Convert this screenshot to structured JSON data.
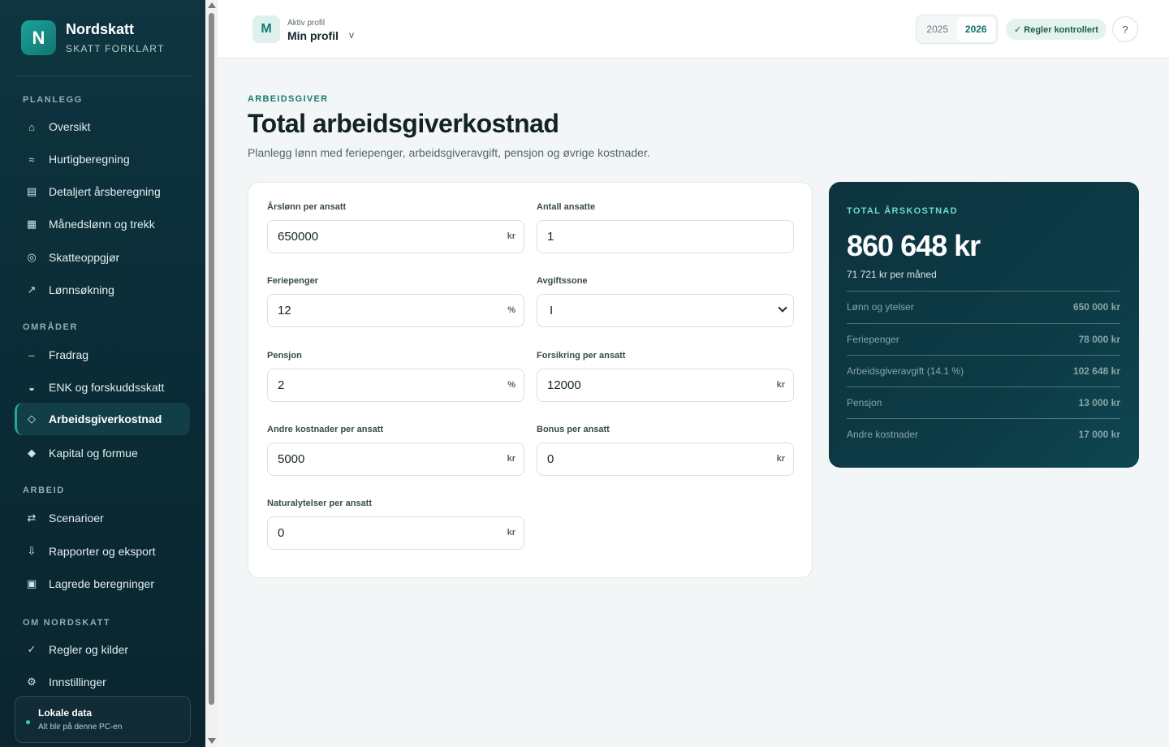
{
  "brand": {
    "logo_letter": "N",
    "name": "Nordskatt",
    "subtitle": "SKATT FORKLART"
  },
  "sidebar": {
    "sections": [
      {
        "label": "PLANLEGG"
      },
      {
        "label": "OMRÅDER"
      },
      {
        "label": "ARBEID"
      },
      {
        "label": "OM NORDSKATT"
      }
    ],
    "items": [
      {
        "label": "Oversikt",
        "icon": "home-icon",
        "glyph": "⌂"
      },
      {
        "label": "Hurtigberegning",
        "icon": "approx-icon",
        "glyph": "≈"
      },
      {
        "label": "Detaljert årsberegning",
        "icon": "document-icon",
        "glyph": "▤"
      },
      {
        "label": "Månedslønn og trekk",
        "icon": "grid-icon",
        "glyph": "▦"
      },
      {
        "label": "Skatteoppgjør",
        "icon": "target-icon",
        "glyph": "◎"
      },
      {
        "label": "Lønnsøkning",
        "icon": "trend-up-icon",
        "glyph": "↗"
      },
      {
        "label": "Fradrag",
        "icon": "minus-icon",
        "glyph": "–"
      },
      {
        "label": "ENK og forskuddsskatt",
        "icon": "half-circle-icon",
        "glyph": "◒"
      },
      {
        "label": "Arbeidsgiverkostnad",
        "icon": "diamond-outline-icon",
        "glyph": "◇",
        "active": true
      },
      {
        "label": "Kapital og formue",
        "icon": "diamond-icon",
        "glyph": "◆"
      },
      {
        "label": "Scenarioer",
        "icon": "swap-icon",
        "glyph": "⇄"
      },
      {
        "label": "Rapporter og eksport",
        "icon": "download-icon",
        "glyph": "⇩"
      },
      {
        "label": "Lagrede beregninger",
        "icon": "save-icon",
        "glyph": "▣"
      },
      {
        "label": "Regler og kilder",
        "icon": "check-icon",
        "glyph": "✓"
      },
      {
        "label": "Innstillinger",
        "icon": "gear-icon",
        "glyph": "⚙"
      }
    ],
    "local_data": {
      "title": "Lokale data",
      "subtitle": "Alt blir på denne PC-en"
    }
  },
  "header": {
    "profile": {
      "avatar_letter": "M",
      "caption": "Aktiv profil",
      "name": "Min profil",
      "chevron": "v"
    },
    "years": [
      "2025",
      "2026"
    ],
    "active_year": "2026",
    "rules_badge": "✓ Regler kontrollert",
    "help": "?"
  },
  "page": {
    "eyebrow": "ARBEIDSGIVER",
    "title": "Total arbeidsgiverkostnad",
    "description": "Planlegg lønn med feriepenger, arbeidsgiveravgift, pensjon og øvrige kostnader."
  },
  "form": {
    "annual_salary": {
      "label": "Årslønn per ansatt",
      "value": "650000",
      "unit": "kr"
    },
    "employees": {
      "label": "Antall ansatte",
      "value": "1"
    },
    "holiday_pay": {
      "label": "Feriepenger",
      "value": "12",
      "unit": "%"
    },
    "tax_zone": {
      "label": "Avgiftssone",
      "value": "I"
    },
    "pension": {
      "label": "Pensjon",
      "value": "2",
      "unit": "%"
    },
    "insurance": {
      "label": "Forsikring per ansatt",
      "value": "12000",
      "unit": "kr"
    },
    "other_costs": {
      "label": "Andre kostnader per ansatt",
      "value": "5000",
      "unit": "kr"
    },
    "bonus": {
      "label": "Bonus per ansatt",
      "value": "0",
      "unit": "kr"
    },
    "benefits": {
      "label": "Naturalytelser per ansatt",
      "value": "0",
      "unit": "kr"
    }
  },
  "summary": {
    "eyebrow": "TOTAL ÅRSKOSTNAD",
    "total": "860 648 kr",
    "per_month": "71 721 kr per måned",
    "rows": [
      {
        "label": "Lønn og ytelser",
        "value": "650 000 kr"
      },
      {
        "label": "Feriepenger",
        "value": "78 000 kr"
      },
      {
        "label": "Arbeidsgiveravgift (14.1 %)",
        "value": "102 648 kr"
      },
      {
        "label": "Pensjon",
        "value": "13 000 kr"
      },
      {
        "label": "Andre kostnader",
        "value": "17 000 kr"
      }
    ]
  }
}
